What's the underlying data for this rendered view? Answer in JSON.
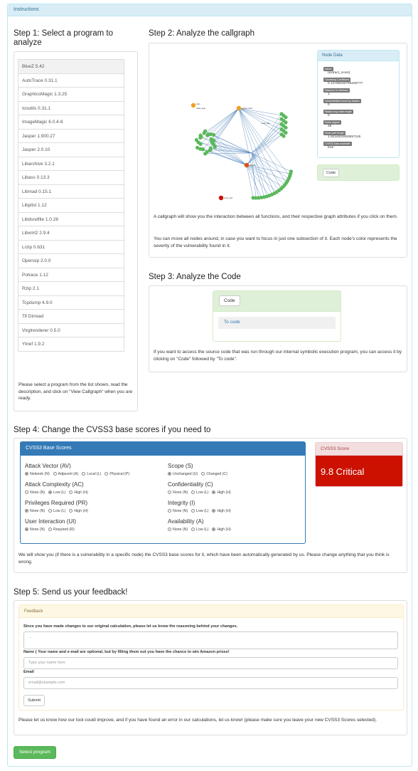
{
  "panel": {
    "title": "Instructions"
  },
  "step1": {
    "title": "Step 1: Select a program to analyze",
    "programs": [
      "BlueZ 5.42",
      "AutoTrace 0.31.1",
      "GraphicsMagic 1.3.25",
      "Icoutils 0.31.1",
      "ImageMagic 6.0.4-8",
      "Jasper 1.900.27",
      "Jasper 2.0.10",
      "Libarchive 3.2.1",
      "Libass 0.13.3",
      "Libmad 0.15.1",
      "Libplist 1.12",
      "Libdsndfile 1.0.28",
      "Libxml2 2.9.4",
      "Lrzip 0.631",
      "Opensip 2.0.0",
      "Potrace 1.12",
      "Rzip 2.1",
      "Tcpdump 4.9.0",
      "Tif Dirread",
      "Virglrenderer 0.5.0",
      "Ytnef 1.9.2"
    ],
    "help": "Please select a program from the list shown, read the description, and click on \"View Callgraph\" when you are ready."
  },
  "step2": {
    "title": "Step 2: Analyze the callgraph",
    "graph_labels": [
      "main",
      "parse_args",
      "extract_icons",
      "decode",
      "read_data",
      "errno_calc"
    ],
    "node_data": {
      "title": "Node Data",
      "fields": [
        {
          "label": "Name",
          "value": "(extract_icons)"
        },
        {
          "label": "Clustering Coefficient",
          "value": "0.14769230769230777"
        },
        {
          "label": "Distance to Interface",
          "value": "1"
        },
        {
          "label": "Vulnerabilities found by Madko",
          "value": "0"
        },
        {
          "label": "Madko bug chain length",
          "value": "0"
        },
        {
          "label": "Node degree",
          "value": "26"
        },
        {
          "label": "Node path length",
          "value": "1.9216323453657115"
        },
        {
          "label": "CVSS3 Data available",
          "value": "true"
        }
      ]
    },
    "code_button": "Code",
    "desc1": "A callgraph will show you the interaction between all functions, and their respective graph attributes if you click on them.",
    "desc2": "You can move all nodes around, in case you want to focus in just one subsection of it. Each node's color represents the severity of the vulnerability found in it."
  },
  "step3": {
    "title": "Step 3: Analyze the Code",
    "code_button": "Code",
    "to_code": "To code",
    "desc": "If you want to access the source code that was run through our internal symbolic execution program, you can access it by clicking on \"Code\" followed by \"To code\"."
  },
  "step4": {
    "title": "Step 4: Change the CVSS3 base scores if you need to",
    "panel_title": "CVSS3 Base Scores",
    "metrics_left": [
      {
        "name": "Attack Vector (AV)",
        "options": [
          "Network (N)",
          "Adjacent (A)",
          "Local (L)",
          "Physical (P)"
        ],
        "selected": 0
      },
      {
        "name": "Attack Complexity (AC)",
        "options": [
          "None (N)",
          "Low (L)",
          "High (H)"
        ],
        "selected": 1
      },
      {
        "name": "Privileges Required (PR)",
        "options": [
          "None (N)",
          "Low (L)",
          "High (H)"
        ],
        "selected": 0
      },
      {
        "name": "User Interaction (UI)",
        "options": [
          "None (N)",
          "Required (R)"
        ],
        "selected": 0
      }
    ],
    "metrics_right": [
      {
        "name": "Scope (S)",
        "options": [
          "Unchanged (U)",
          "Changed (C)"
        ],
        "selected": 0
      },
      {
        "name": "Confidentiality (C)",
        "options": [
          "None (N)",
          "Low (L)",
          "High (H)"
        ],
        "selected": 2
      },
      {
        "name": "Integrity (I)",
        "options": [
          "None (N)",
          "Low (L)",
          "High (H)"
        ],
        "selected": 2
      },
      {
        "name": "Availability (A)",
        "options": [
          "None (N)",
          "Low (L)",
          "High (H)"
        ],
        "selected": 2
      }
    ],
    "score_title": "CVSS3 Score",
    "score_value": "9.8 Critical",
    "score_color": "#cc1100",
    "desc": "We will show you (if there is a vulnerability in a specific node) the CVSS3 base scores for it, which have been automatically generated by us. Please change anything that you think is wrong."
  },
  "step5": {
    "title": "Step 5: Send us your feedback!",
    "panel_title": "Feedback",
    "reason_label": "Since you have made changes to our original calculation, please let us know the reasoning behind your changes.",
    "reason_placeholder": "...",
    "name_label": "Name ( Your name and e-mail are optional, but by filling them out you have the chance to win Amazon prizes!",
    "name_placeholder": "Type your name here",
    "email_label": "Email",
    "email_placeholder": "email@example.com",
    "submit": "Submit",
    "desc": "Please let us know how our tool could improve, and if you have found an error in our calculations, let us know! (please make sure you leave your new CVSS3 Scores selected)."
  },
  "footer": {
    "select_program": "Select program"
  }
}
